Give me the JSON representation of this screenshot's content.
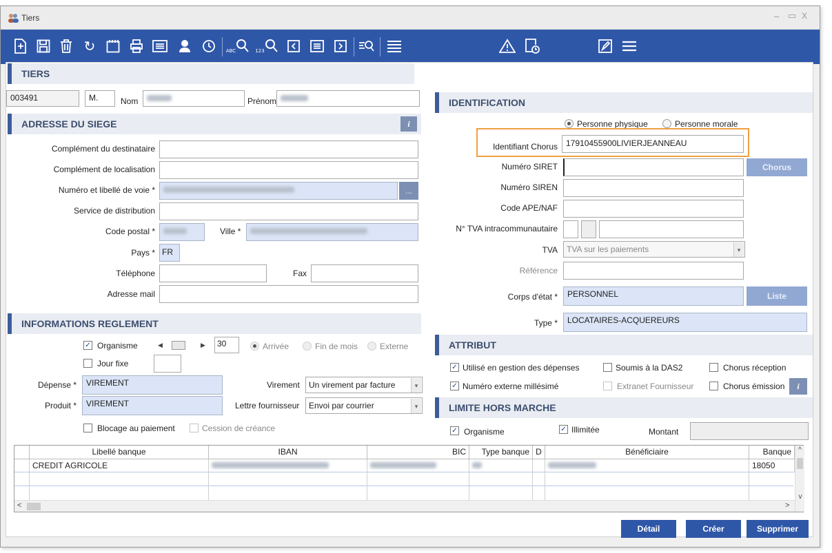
{
  "window": {
    "title": "Tiers",
    "controls": {
      "minimize": "–",
      "maximize": "▭",
      "close": "X"
    }
  },
  "toolbar": {
    "icons": [
      "new-doc-icon",
      "save-icon",
      "delete-icon",
      "refresh-icon",
      "calendar-icon",
      "print-icon",
      "list-view-icon",
      "person-icon",
      "history-icon",
      "search-abc-icon",
      "search-123-icon",
      "prev-icon",
      "record-icon",
      "next-icon",
      "filter-search-icon",
      "list-icon",
      "warning-icon",
      "document-clock-icon",
      "edit-icon",
      "menu-icon"
    ],
    "abc_label": "ABC",
    "num_label": "123"
  },
  "tiers": {
    "header": "TIERS",
    "code": "003491",
    "civility": "M.",
    "nom_label": "Nom",
    "prenom_label": "Prénom"
  },
  "address": {
    "header": "ADRESSE DU SIEGE",
    "info": "i",
    "complement_dest_label": "Complément du destinataire",
    "complement_loc_label": "Complément de localisation",
    "voie_label": "Numéro et libellé de voie *",
    "voie_btn": "...",
    "service_label": "Service de distribution",
    "cp_label": "Code postal *",
    "ville_label": "Ville *",
    "pays_label": "Pays *",
    "pays_value": "FR",
    "tel_label": "Téléphone",
    "fax_label": "Fax",
    "mail_label": "Adresse mail"
  },
  "reglement": {
    "header": "INFORMATIONS REGLEMENT",
    "organisme_label": "Organisme",
    "organisme_checked": "✓",
    "delay_value": "30",
    "arrivee_label": "Arrivée",
    "fin_mois_label": "Fin de mois",
    "externe_label": "Externe",
    "jour_fixe_label": "Jour fixe",
    "depense_label": "Dépense *",
    "depense_value": "VIREMENT",
    "produit_label": "Produit *",
    "produit_value": "VIREMENT",
    "virement_label": "Virement",
    "virement_value": "Un virement par facture",
    "lettre_label": "Lettre fournisseur",
    "lettre_value": "Envoi par courrier",
    "blocage_label": "Blocage au paiement",
    "cession_label": "Cession de créance"
  },
  "identification": {
    "header": "IDENTIFICATION",
    "physique_label": "Personne physique",
    "morale_label": "Personne morale",
    "chorus_id_label": "Identifiant Chorus",
    "chorus_id_value": "17910455900LIVIERJEANNEAU",
    "siret_label": "Numéro SIRET",
    "chorus_btn": "Chorus",
    "siren_label": "Numéro SIREN",
    "ape_label": "Code APE/NAF",
    "tva_intra_label": "N° TVA intracommunautaire",
    "tva_label": "TVA",
    "tva_value": "TVA sur les paiements",
    "ref_label": "Référence",
    "corps_label": "Corps d'état *",
    "corps_value": "PERSONNEL",
    "liste_btn": "Liste",
    "type_label": "Type *",
    "type_value": "LOCATAIRES-ACQUEREURS"
  },
  "attribut": {
    "header": "ATTRIBUT",
    "gestion_label": "Utilisé en gestion des dépenses",
    "das2_label": "Soumis à la DAS2",
    "chorus_rec_label": "Chorus réception",
    "num_ext_label": "Numéro externe millésimé",
    "extranet_label": "Extranet Fournisseur",
    "chorus_emi_label": "Chorus émission",
    "info": "i",
    "checked": "✓"
  },
  "limite": {
    "header": "LIMITE HORS MARCHE",
    "organisme_label": "Organisme",
    "illimitee_label": "Illimitée",
    "montant_label": "Montant"
  },
  "bank_table": {
    "columns": [
      "Libellé banque",
      "IBAN",
      "BIC",
      "Type banque",
      "D",
      "Bénéficiaire",
      "Banque"
    ],
    "rows": [
      {
        "libelle": "CREDIT AGRICOLE",
        "banque": "18050"
      }
    ],
    "scroll_left": "<",
    "scroll_right": ">",
    "scroll_up": "^",
    "scroll_down": "v"
  },
  "actions": {
    "detail": "Détail",
    "creer": "Créer",
    "supprimer": "Supprimer"
  },
  "colors": {
    "toolbar": "#2f57a8",
    "header_bg": "#e9ecf2",
    "header_text": "#3c4e6e",
    "required_bg": "#dbe5f7",
    "highlight": "#f0a040"
  }
}
